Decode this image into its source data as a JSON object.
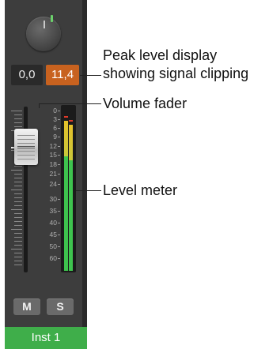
{
  "channel_strip": {
    "volume_value": "0,0",
    "peak_value": "11,4",
    "fader_scale": [
      "0",
      "3",
      "6",
      "9",
      "12",
      "15",
      "18",
      "21",
      "24",
      "30",
      "35",
      "40",
      "45",
      "50",
      "60"
    ],
    "mute_label": "M",
    "solo_label": "S",
    "track_name": "Inst 1",
    "colors": {
      "strip": "#3d3d3d",
      "peak_clip": "#c8621f",
      "track_name_bar": "#3fae4a",
      "meter_green": "#3ec44e",
      "meter_yellow": "#e6c12a"
    }
  },
  "callouts": {
    "peak_display_line1": "Peak level display",
    "peak_display_line2": "showing signal clipping",
    "volume_fader": "Volume fader",
    "level_meter": "Level meter"
  }
}
